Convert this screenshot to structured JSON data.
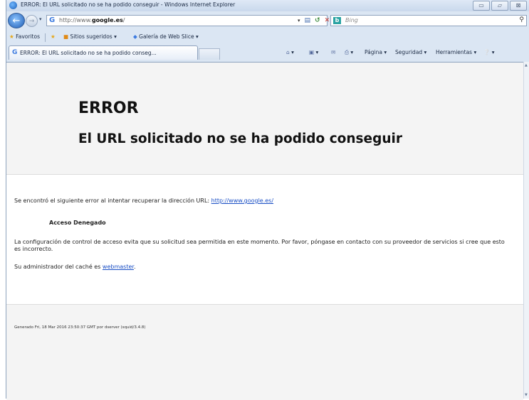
{
  "window": {
    "title": "ERROR: El URL solicitado no se ha podido conseguir - Windows Internet Explorer",
    "min": "▭",
    "restore": "▱",
    "close": "⊠"
  },
  "address_bar": {
    "url_prefix": "http://www.",
    "url_domain": "google.es",
    "url_suffix": "/"
  },
  "search": {
    "engine_badge": "b",
    "placeholder": "Bing"
  },
  "favorites_bar": {
    "favorites": "Favoritos",
    "suggested": "Sitios sugeridos ▾",
    "gallery": "Galería de Web Slice ▾"
  },
  "tab": {
    "title": "ERROR: El URL solicitado no se ha podido conseg..."
  },
  "command_bar": {
    "home": "▾",
    "feeds": "▾",
    "print": "▾",
    "page": "Página ▾",
    "safety": "Seguridad ▾",
    "tools": "Herramientas ▾",
    "help": "▾"
  },
  "page": {
    "error_title": "ERROR",
    "error_subtitle": "El URL solicitado no se ha podido conseguir",
    "retrieve_text": "Se encontró el siguiente error al intentar recuperar la dirección URL: ",
    "retrieve_link": "http://www.google.es/",
    "access_denied": "Acceso Denegado",
    "policy_text": "La configuración de control de acceso evita que su solicitud sea permitida en este momento. Por favor, póngase en contacto con su proveedor de servicios si cree que esto es incorrecto.",
    "admin_text": "Su administrador del caché es ",
    "admin_link": "webmaster",
    "admin_period": ".",
    "footer": "Generado Fri, 18 Mar 2016 23:50:37 GMT por dserver (squid/3.4.8)"
  }
}
